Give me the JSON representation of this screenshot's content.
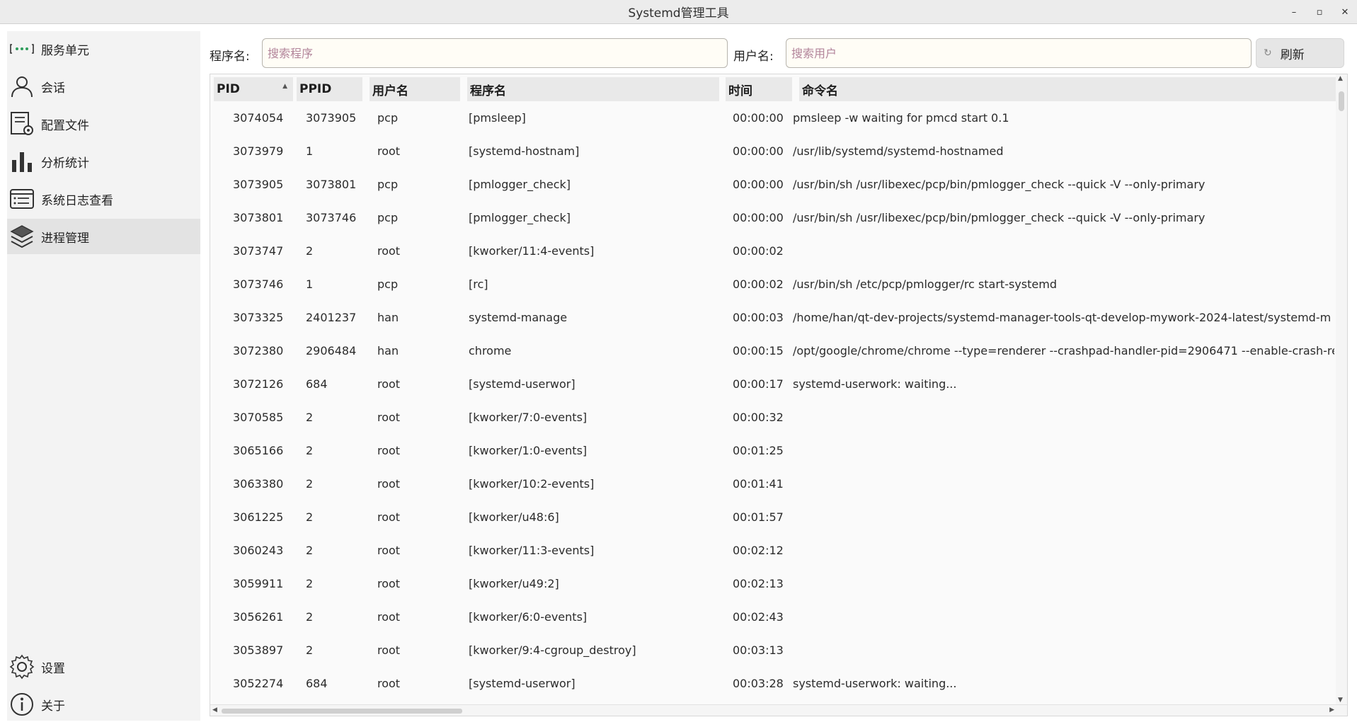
{
  "window": {
    "title": "Systemd管理工具",
    "minimize": "–",
    "maximize": "▫",
    "close": "✕"
  },
  "sidebar": {
    "items": [
      {
        "label": "服务单元",
        "icon": "service-unit-icon"
      },
      {
        "label": "会话",
        "icon": "user-session-icon"
      },
      {
        "label": "配置文件",
        "icon": "config-file-icon"
      },
      {
        "label": "分析统计",
        "icon": "bar-chart-icon"
      },
      {
        "label": "系统日志查看",
        "icon": "log-viewer-icon"
      },
      {
        "label": "进程管理",
        "icon": "layers-icon",
        "active": true
      }
    ],
    "bottom_items": [
      {
        "label": "设置",
        "icon": "gear-icon"
      },
      {
        "label": "关于",
        "icon": "info-icon"
      }
    ]
  },
  "search": {
    "program_label": "程序名:",
    "program_placeholder": "搜索程序",
    "program_value": "",
    "user_label": "用户名:",
    "user_placeholder": "搜索用户",
    "user_value": "",
    "refresh_label": "刷新",
    "refresh_icon": "↻"
  },
  "table": {
    "columns": [
      "PID",
      "PPID",
      "用户名",
      "程序名",
      "时间",
      "命令名"
    ],
    "sort_column": "PID",
    "sort_indicator": "▲",
    "rows": [
      [
        "3074054",
        "3073905",
        "pcp",
        "[pmsleep]",
        "00:00:00",
        "pmsleep -w waiting for pmcd start 0.1"
      ],
      [
        "3073979",
        "1",
        "root",
        "[systemd-hostnam]",
        "00:00:00",
        "/usr/lib/systemd/systemd-hostnamed"
      ],
      [
        "3073905",
        "3073801",
        "pcp",
        "[pmlogger_check]",
        "00:00:00",
        "/usr/bin/sh /usr/libexec/pcp/bin/pmlogger_check --quick -V --only-primary"
      ],
      [
        "3073801",
        "3073746",
        "pcp",
        "[pmlogger_check]",
        "00:00:00",
        "/usr/bin/sh /usr/libexec/pcp/bin/pmlogger_check --quick -V --only-primary"
      ],
      [
        "3073747",
        "2",
        "root",
        "[kworker/11:4-events]",
        "00:00:02",
        ""
      ],
      [
        "3073746",
        "1",
        "pcp",
        "[rc]",
        "00:00:02",
        "/usr/bin/sh /etc/pcp/pmlogger/rc start-systemd"
      ],
      [
        "3073325",
        "2401237",
        "han",
        "systemd-manage",
        "00:00:03",
        "/home/han/qt-dev-projects/systemd-manager-tools-qt-develop-mywork-2024-latest/systemd-m"
      ],
      [
        "3072380",
        "2906484",
        "han",
        "chrome",
        "00:00:15",
        "/opt/google/chrome/chrome --type=renderer --crashpad-handler-pid=2906471 --enable-crash-re"
      ],
      [
        "3072126",
        "684",
        "root",
        "[systemd-userwor]",
        "00:00:17",
        "systemd-userwork: waiting..."
      ],
      [
        "3070585",
        "2",
        "root",
        "[kworker/7:0-events]",
        "00:00:32",
        ""
      ],
      [
        "3065166",
        "2",
        "root",
        "[kworker/1:0-events]",
        "00:01:25",
        ""
      ],
      [
        "3063380",
        "2",
        "root",
        "[kworker/10:2-events]",
        "00:01:41",
        ""
      ],
      [
        "3061225",
        "2",
        "root",
        "[kworker/u48:6]",
        "00:01:57",
        ""
      ],
      [
        "3060243",
        "2",
        "root",
        "[kworker/11:3-events]",
        "00:02:12",
        ""
      ],
      [
        "3059911",
        "2",
        "root",
        "[kworker/u49:2]",
        "00:02:13",
        ""
      ],
      [
        "3056261",
        "2",
        "root",
        "[kworker/6:0-events]",
        "00:02:43",
        ""
      ],
      [
        "3053897",
        "2",
        "root",
        "[kworker/9:4-cgroup_destroy]",
        "00:03:13",
        ""
      ],
      [
        "3052274",
        "684",
        "root",
        "[systemd-userwor]",
        "00:03:28",
        "systemd-userwork: waiting..."
      ]
    ]
  },
  "scrollbars": {
    "up": "▲",
    "down": "▼",
    "left": "◀",
    "right": "▶"
  }
}
